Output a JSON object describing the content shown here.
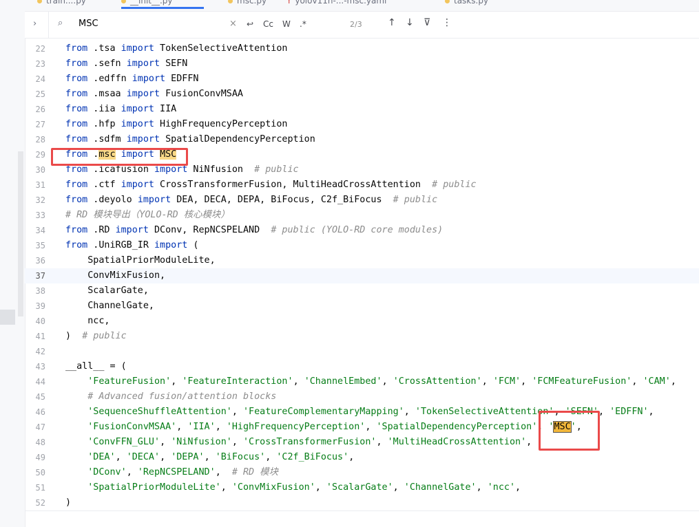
{
  "tabs": [
    {
      "label": "train....py",
      "active": false
    },
    {
      "label": "__init__.py",
      "active": true
    },
    {
      "label": "msc.py",
      "active": false
    },
    {
      "label": "yolov11n-...-msc.yaml",
      "active": false
    },
    {
      "label": "tasks.py",
      "active": false
    }
  ],
  "find": {
    "query": "MSC",
    "match_case": "Cc",
    "words": "W",
    "regex": ".*",
    "count": "2/3"
  },
  "current_line": 37,
  "lines": [
    {
      "n": "22",
      "tokens": [
        [
          "kw",
          "from"
        ],
        [
          "t",
          " .tsa "
        ],
        [
          "kw",
          "import"
        ],
        [
          "t",
          " TokenSelectiveAttention"
        ]
      ]
    },
    {
      "n": "23",
      "tokens": [
        [
          "kw",
          "from"
        ],
        [
          "t",
          " .sefn "
        ],
        [
          "kw",
          "import"
        ],
        [
          "t",
          " SEFN"
        ]
      ]
    },
    {
      "n": "24",
      "tokens": [
        [
          "kw",
          "from"
        ],
        [
          "t",
          " .edffn "
        ],
        [
          "kw",
          "import"
        ],
        [
          "t",
          " EDFFN"
        ]
      ]
    },
    {
      "n": "25",
      "tokens": [
        [
          "kw",
          "from"
        ],
        [
          "t",
          " .msaa "
        ],
        [
          "kw",
          "import"
        ],
        [
          "t",
          " FusionConvMSAA"
        ]
      ]
    },
    {
      "n": "26",
      "tokens": [
        [
          "kw",
          "from"
        ],
        [
          "t",
          " .iia "
        ],
        [
          "kw",
          "import"
        ],
        [
          "t",
          " IIA"
        ]
      ]
    },
    {
      "n": "27",
      "tokens": [
        [
          "kw",
          "from"
        ],
        [
          "t",
          " .hfp "
        ],
        [
          "kw",
          "import"
        ],
        [
          "t",
          " HighFrequencyPerception"
        ]
      ]
    },
    {
      "n": "28",
      "tokens": [
        [
          "kw",
          "from"
        ],
        [
          "t",
          " .sdfm "
        ],
        [
          "kw",
          "import"
        ],
        [
          "t",
          " SpatialDependencyPerception"
        ]
      ]
    },
    {
      "n": "29",
      "tokens": [
        [
          "kw",
          "from"
        ],
        [
          "t",
          " ."
        ],
        [
          "hl",
          "msc"
        ],
        [
          "t",
          " "
        ],
        [
          "kw",
          "import"
        ],
        [
          "t",
          " "
        ],
        [
          "hl",
          "MSC"
        ]
      ]
    },
    {
      "n": "30",
      "tokens": [
        [
          "kw",
          "from"
        ],
        [
          "t",
          " .icafusion "
        ],
        [
          "kw",
          "import"
        ],
        [
          "t",
          " NiNfusion  "
        ],
        [
          "cmt",
          "# public"
        ]
      ]
    },
    {
      "n": "31",
      "tokens": [
        [
          "kw",
          "from"
        ],
        [
          "t",
          " .ctf "
        ],
        [
          "kw",
          "import"
        ],
        [
          "t",
          " CrossTransformerFusion, MultiHeadCrossAttention  "
        ],
        [
          "cmt",
          "# public"
        ]
      ]
    },
    {
      "n": "32",
      "tokens": [
        [
          "kw",
          "from"
        ],
        [
          "t",
          " .deyolo "
        ],
        [
          "kw",
          "import"
        ],
        [
          "t",
          " DEA, DECA, DEPA, BiFocus, C2f_BiFocus  "
        ],
        [
          "cmt",
          "# public"
        ]
      ]
    },
    {
      "n": "33",
      "tokens": [
        [
          "cmt",
          "# RD 模块导出（YOLO-RD 核心模块）"
        ]
      ]
    },
    {
      "n": "34",
      "tokens": [
        [
          "kw",
          "from"
        ],
        [
          "t",
          " .RD "
        ],
        [
          "kw",
          "import"
        ],
        [
          "t",
          " DConv, RepNCSPELAND  "
        ],
        [
          "cmt",
          "# public (YOLO-RD core modules)"
        ]
      ]
    },
    {
      "n": "35",
      "tokens": [
        [
          "kw",
          "from"
        ],
        [
          "t",
          " .UniRGB_IR "
        ],
        [
          "kw",
          "import"
        ],
        [
          "t",
          " ("
        ]
      ]
    },
    {
      "n": "36",
      "tokens": [
        [
          "t",
          "    SpatialPriorModuleLite,"
        ]
      ]
    },
    {
      "n": "37",
      "tokens": [
        [
          "t",
          "    ConvMixFusion,"
        ]
      ]
    },
    {
      "n": "38",
      "tokens": [
        [
          "t",
          "    ScalarGate,"
        ]
      ]
    },
    {
      "n": "39",
      "tokens": [
        [
          "t",
          "    ChannelGate,"
        ]
      ]
    },
    {
      "n": "40",
      "tokens": [
        [
          "t",
          "    ncc,"
        ]
      ]
    },
    {
      "n": "41",
      "tokens": [
        [
          "t",
          ")  "
        ],
        [
          "cmt",
          "# public"
        ]
      ]
    },
    {
      "n": "42",
      "tokens": []
    },
    {
      "n": "43",
      "tokens": [
        [
          "t",
          "__all__ = ("
        ]
      ]
    },
    {
      "n": "44",
      "tokens": [
        [
          "t",
          "    "
        ],
        [
          "str",
          "'FeatureFusion'"
        ],
        [
          "t",
          ", "
        ],
        [
          "str",
          "'FeatureInteraction'"
        ],
        [
          "t",
          ", "
        ],
        [
          "str",
          "'ChannelEmbed'"
        ],
        [
          "t",
          ", "
        ],
        [
          "str",
          "'CrossAttention'"
        ],
        [
          "t",
          ", "
        ],
        [
          "str",
          "'FCM'"
        ],
        [
          "t",
          ", "
        ],
        [
          "str",
          "'FCMFeatureFusion'"
        ],
        [
          "t",
          ", "
        ],
        [
          "str",
          "'CAM'"
        ],
        [
          "t",
          ","
        ]
      ]
    },
    {
      "n": "45",
      "tokens": [
        [
          "t",
          "    "
        ],
        [
          "cmt",
          "# Advanced fusion/attention blocks"
        ]
      ]
    },
    {
      "n": "46",
      "tokens": [
        [
          "t",
          "    "
        ],
        [
          "str",
          "'SequenceShuffleAttention'"
        ],
        [
          "t",
          ", "
        ],
        [
          "str",
          "'FeatureComplementaryMapping'"
        ],
        [
          "t",
          ", "
        ],
        [
          "str",
          "'TokenSelectiveAttention'"
        ],
        [
          "t",
          ", "
        ],
        [
          "str",
          "'SEFN'"
        ],
        [
          "t",
          ", "
        ],
        [
          "str",
          "'EDFFN'"
        ],
        [
          "t",
          ","
        ]
      ]
    },
    {
      "n": "47",
      "tokens": [
        [
          "t",
          "    "
        ],
        [
          "str",
          "'FusionConvMSAA'"
        ],
        [
          "t",
          ", "
        ],
        [
          "str",
          "'IIA'"
        ],
        [
          "t",
          ", "
        ],
        [
          "str",
          "'HighFrequencyPerception'"
        ],
        [
          "t",
          ", "
        ],
        [
          "str",
          "'SpatialDependencyPerception'"
        ],
        [
          "t",
          ", "
        ],
        [
          "str",
          "'"
        ],
        [
          "hl2",
          "MSC"
        ],
        [
          "str",
          "'"
        ],
        [
          "t",
          ","
        ]
      ]
    },
    {
      "n": "48",
      "tokens": [
        [
          "t",
          "    "
        ],
        [
          "str",
          "'ConvFFN_GLU'"
        ],
        [
          "t",
          ", "
        ],
        [
          "str",
          "'NiNfusion'"
        ],
        [
          "t",
          ", "
        ],
        [
          "str",
          "'CrossTransformerFusion'"
        ],
        [
          "t",
          ", "
        ],
        [
          "str",
          "'MultiHeadCrossAttention'"
        ],
        [
          "t",
          ","
        ]
      ]
    },
    {
      "n": "49",
      "tokens": [
        [
          "t",
          "    "
        ],
        [
          "str",
          "'DEA'"
        ],
        [
          "t",
          ", "
        ],
        [
          "str",
          "'DECA'"
        ],
        [
          "t",
          ", "
        ],
        [
          "str",
          "'DEPA'"
        ],
        [
          "t",
          ", "
        ],
        [
          "str",
          "'BiFocus'"
        ],
        [
          "t",
          ", "
        ],
        [
          "str",
          "'C2f_BiFocus'"
        ],
        [
          "t",
          ","
        ]
      ]
    },
    {
      "n": "50",
      "tokens": [
        [
          "t",
          "    "
        ],
        [
          "str",
          "'DConv'"
        ],
        [
          "t",
          ", "
        ],
        [
          "str",
          "'RepNCSPELAND'"
        ],
        [
          "t",
          ",  "
        ],
        [
          "cmt",
          "# RD 模块"
        ]
      ]
    },
    {
      "n": "51",
      "tokens": [
        [
          "t",
          "    "
        ],
        [
          "str",
          "'SpatialPriorModuleLite'"
        ],
        [
          "t",
          ", "
        ],
        [
          "str",
          "'ConvMixFusion'"
        ],
        [
          "t",
          ", "
        ],
        [
          "str",
          "'ScalarGate'"
        ],
        [
          "t",
          ", "
        ],
        [
          "str",
          "'ChannelGate'"
        ],
        [
          "t",
          ", "
        ],
        [
          "str",
          "'ncc'"
        ],
        [
          "t",
          ","
        ]
      ]
    },
    {
      "n": "52",
      "tokens": [
        [
          "t",
          ")"
        ]
      ]
    }
  ]
}
